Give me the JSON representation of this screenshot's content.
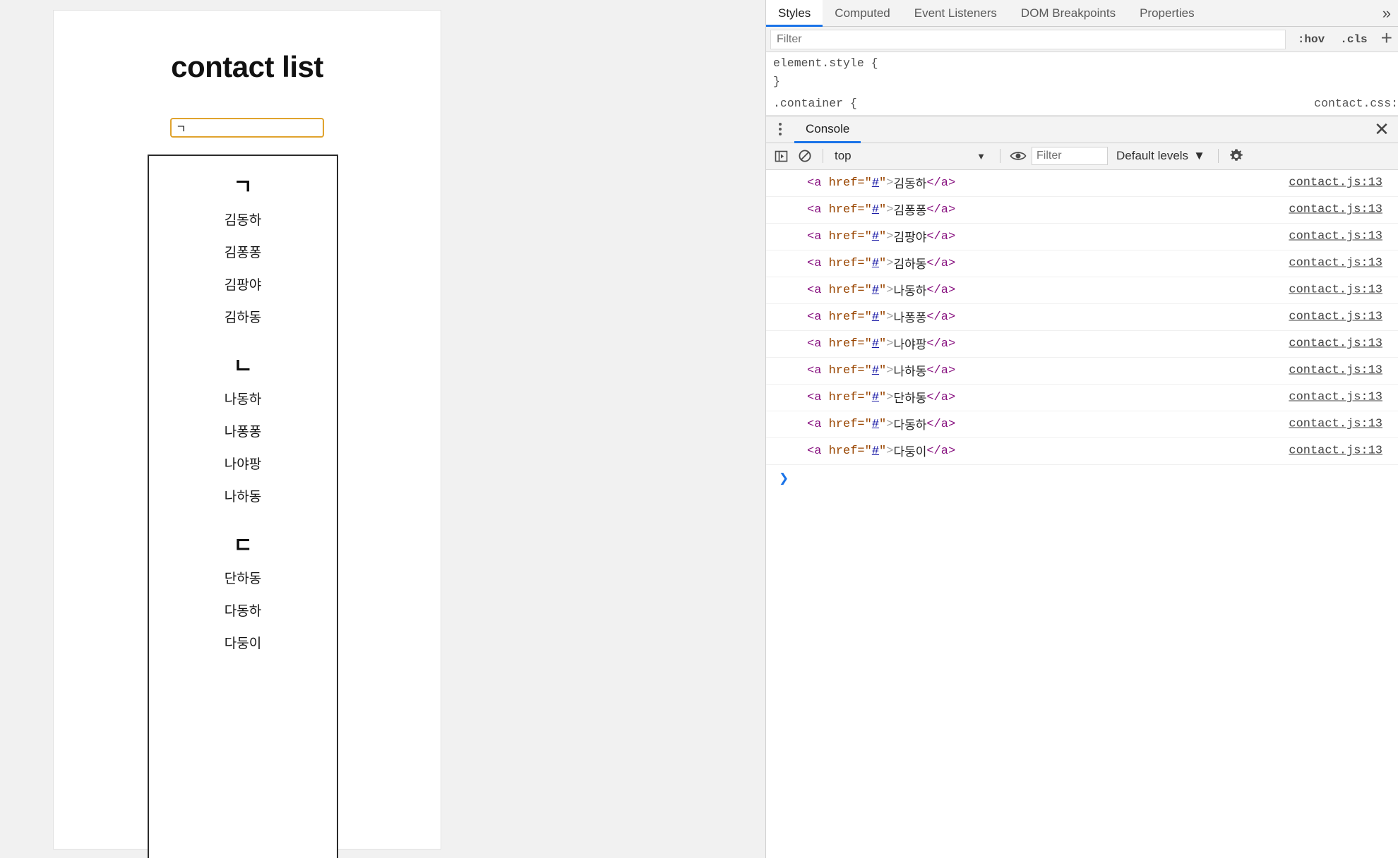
{
  "page": {
    "title": "contact list",
    "search": {
      "value": "ㄱ",
      "placeholder": ""
    },
    "groups": [
      {
        "letter": "ㄱ",
        "names": [
          "김동하",
          "김퐁퐁",
          "김팡야",
          "김하동"
        ]
      },
      {
        "letter": "ㄴ",
        "names": [
          "나동하",
          "나퐁퐁",
          "나야팡",
          "나하동"
        ]
      },
      {
        "letter": "ㄷ",
        "names": [
          "단하동",
          "다동하",
          "다둥이"
        ]
      }
    ]
  },
  "devtools": {
    "tabs": [
      {
        "label": "Styles",
        "active": true
      },
      {
        "label": "Computed",
        "active": false
      },
      {
        "label": "Event Listeners",
        "active": false
      },
      {
        "label": "DOM Breakpoints",
        "active": false
      },
      {
        "label": "Properties",
        "active": false
      }
    ],
    "more_label": "»",
    "styles_filter": {
      "value": "",
      "placeholder": "Filter"
    },
    "hov_label": ":hov",
    "cls_label": ".cls",
    "new_rule_label": "+",
    "rules": [
      {
        "selector": "element.style {",
        "close": "}",
        "source": ""
      },
      {
        "selector": ".container {",
        "close": "",
        "source": "contact.css:"
      }
    ],
    "drawer": {
      "tab_label": "Console",
      "close_label": "✕",
      "toolbar": {
        "sidebar_icon": "show-console-sidebar-icon",
        "clear_icon": "clear-console-icon",
        "context": "top",
        "context_caret": "▼",
        "eye_icon": "live-expression-icon",
        "filter": {
          "value": "",
          "placeholder": "Filter"
        },
        "levels_label": "Default levels",
        "levels_caret": "▼",
        "settings_icon": "gear-icon"
      },
      "logs": [
        {
          "tag_open": "<a",
          "attr": "href=",
          "quote": "\"",
          "value": "#",
          "gt": ">",
          "text": "김동하",
          "tag_close": "</a>",
          "source": "contact.js:13"
        },
        {
          "tag_open": "<a",
          "attr": "href=",
          "quote": "\"",
          "value": "#",
          "gt": ">",
          "text": "김퐁퐁",
          "tag_close": "</a>",
          "source": "contact.js:13"
        },
        {
          "tag_open": "<a",
          "attr": "href=",
          "quote": "\"",
          "value": "#",
          "gt": ">",
          "text": "김팡야",
          "tag_close": "</a>",
          "source": "contact.js:13"
        },
        {
          "tag_open": "<a",
          "attr": "href=",
          "quote": "\"",
          "value": "#",
          "gt": ">",
          "text": "김하동",
          "tag_close": "</a>",
          "source": "contact.js:13"
        },
        {
          "tag_open": "<a",
          "attr": "href=",
          "quote": "\"",
          "value": "#",
          "gt": ">",
          "text": "나동하",
          "tag_close": "</a>",
          "source": "contact.js:13"
        },
        {
          "tag_open": "<a",
          "attr": "href=",
          "quote": "\"",
          "value": "#",
          "gt": ">",
          "text": "나퐁퐁",
          "tag_close": "</a>",
          "source": "contact.js:13"
        },
        {
          "tag_open": "<a",
          "attr": "href=",
          "quote": "\"",
          "value": "#",
          "gt": ">",
          "text": "나야팡",
          "tag_close": "</a>",
          "source": "contact.js:13"
        },
        {
          "tag_open": "<a",
          "attr": "href=",
          "quote": "\"",
          "value": "#",
          "gt": ">",
          "text": "나하동",
          "tag_close": "</a>",
          "source": "contact.js:13"
        },
        {
          "tag_open": "<a",
          "attr": "href=",
          "quote": "\"",
          "value": "#",
          "gt": ">",
          "text": "단하동",
          "tag_close": "</a>",
          "source": "contact.js:13"
        },
        {
          "tag_open": "<a",
          "attr": "href=",
          "quote": "\"",
          "value": "#",
          "gt": ">",
          "text": "다동하",
          "tag_close": "</a>",
          "source": "contact.js:13"
        },
        {
          "tag_open": "<a",
          "attr": "href=",
          "quote": "\"",
          "value": "#",
          "gt": ">",
          "text": "다둥이",
          "tag_close": "</a>",
          "source": "contact.js:13"
        }
      ],
      "prompt_symbol": "❯"
    }
  },
  "colors": {
    "accent_blue": "#1a73e8",
    "input_border_orange": "#e0a32e",
    "list_border": "#2b2b2b",
    "tag_purple": "#881280",
    "attr_brown": "#994500",
    "value_blue": "#1a1aa6"
  }
}
